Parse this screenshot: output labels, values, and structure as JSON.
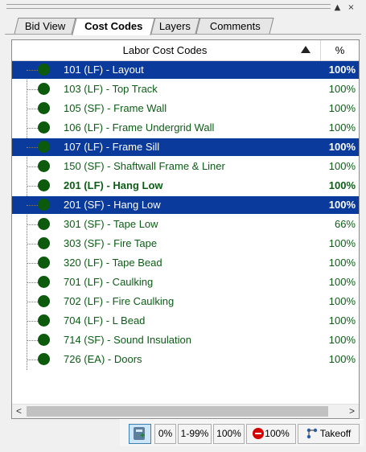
{
  "window": {
    "restore_glyph": "▲",
    "close_glyph": "×"
  },
  "tabs": [
    {
      "label": "Bid View",
      "active": false
    },
    {
      "label": "Cost Codes",
      "active": true
    },
    {
      "label": "Layers",
      "active": false
    },
    {
      "label": "Comments",
      "active": false
    }
  ],
  "table": {
    "header_title": "Labor Cost Codes",
    "header_pct": "%",
    "rows": [
      {
        "label": "101 (LF) - Layout",
        "pct": "100%",
        "selected": true
      },
      {
        "label": "103 (LF) - Top Track",
        "pct": "100%"
      },
      {
        "label": "105 (SF) - Frame Wall",
        "pct": "100%"
      },
      {
        "label": "106 (LF) - Frame Undergrid Wall",
        "pct": "100%"
      },
      {
        "label": "107 (LF) - Frame Sill",
        "pct": "100%",
        "selected": true
      },
      {
        "label": "150 (SF) - Shaftwall Frame & Liner",
        "pct": "100%"
      },
      {
        "label": "201 (LF) - Hang Low",
        "pct": "100%",
        "bold": true
      },
      {
        "label": "201 (SF) - Hang Low",
        "pct": "100%",
        "selected": true
      },
      {
        "label": "301 (SF) - Tape Low",
        "pct": "66%"
      },
      {
        "label": "303 (SF) - Fire Tape",
        "pct": "100%"
      },
      {
        "label": "320 (LF) - Tape Bead",
        "pct": "100%"
      },
      {
        "label": "701 (LF) - Caulking",
        "pct": "100%"
      },
      {
        "label": "702 (LF) - Fire Caulking",
        "pct": "100%"
      },
      {
        "label": "704 (LF) - L Bead",
        "pct": "100%"
      },
      {
        "label": "714 (SF) - Sound Insulation",
        "pct": "100%"
      },
      {
        "label": "726 (EA) - Doors",
        "pct": "100%"
      }
    ]
  },
  "scrollbar": {
    "left_glyph": "<",
    "right_glyph": ">"
  },
  "toolbar": {
    "filter_0": "0%",
    "filter_partial": "1-99%",
    "filter_100": "100%",
    "filter_over": "100%",
    "takeoff": "Takeoff"
  },
  "colors": {
    "selection": "#0a3a9c",
    "row_text": "#0c5c16",
    "status_dot": "#0c5a0c"
  },
  "icons": {
    "status_dot": "green-circle-icon",
    "sort": "sort-ascending-icon",
    "calculator": "calculator-add-icon",
    "over": "stop-icon",
    "takeoff": "takeoff-icon"
  }
}
